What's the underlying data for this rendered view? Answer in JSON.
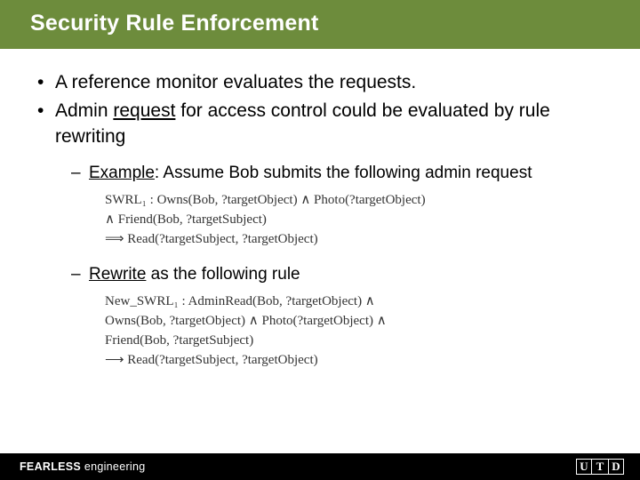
{
  "title": "Security Rule Enforcement",
  "bullets": {
    "b1": "A reference monitor evaluates the requests.",
    "b2_pre": "Admin ",
    "b2_u": "request",
    "b2_post": " for access control could be evaluated by rule rewriting"
  },
  "sub": {
    "s1_u": "Example",
    "s1_rest": ": Assume Bob submits the following admin request",
    "s2_u": "Rewrite",
    "s2_rest": " as the following rule"
  },
  "formula1": {
    "l1": "SWRL₁ :   Owns(Bob, ?targetObject)  ∧  Photo(?targetObject)",
    "l2": "∧  Friend(Bob, ?targetSubject)",
    "l3": "⟹  Read(?targetSubject, ?targetObject)"
  },
  "formula2": {
    "l1": "New_SWRL₁ :   AdminRead(Bob, ?targetObject)  ∧",
    "l2": "Owns(Bob, ?targetObject)  ∧  Photo(?targetObject)  ∧",
    "l3": "Friend(Bob, ?targetSubject)",
    "l4": "⟶  Read(?targetSubject, ?targetObject)"
  },
  "footer": {
    "bold": "FEARLESS",
    "rest": " engineering",
    "logo_u": "U",
    "logo_t": "T",
    "logo_d": "D"
  }
}
